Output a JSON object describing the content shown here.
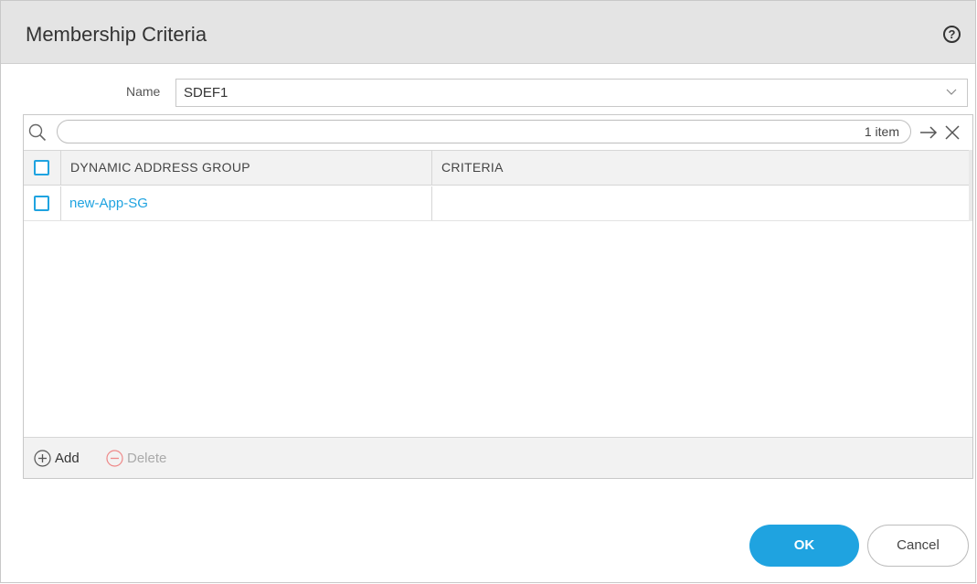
{
  "dialog": {
    "title": "Membership Criteria",
    "help_icon": "help-icon"
  },
  "name_field": {
    "label": "Name",
    "value": "SDEF1"
  },
  "search": {
    "placeholder": "",
    "count": "1 item"
  },
  "table": {
    "columns": [
      "DYNAMIC ADDRESS GROUP",
      "CRITERIA"
    ],
    "rows": [
      {
        "group": "new-App-SG",
        "criteria": ""
      }
    ]
  },
  "footer": {
    "add_label": "Add",
    "delete_label": "Delete"
  },
  "buttons": {
    "ok_label": "OK",
    "cancel_label": "Cancel"
  },
  "colors": {
    "accent": "#1fa3e0",
    "header_bg": "#e4e4e4"
  }
}
